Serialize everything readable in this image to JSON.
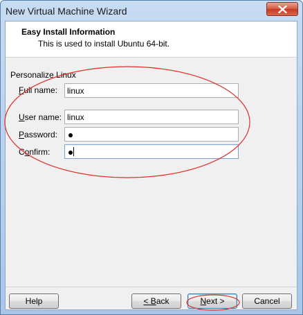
{
  "window": {
    "title": "New Virtual Machine Wizard"
  },
  "header": {
    "title": "Easy Install Information",
    "subtitle": "This is used to install Ubuntu 64-bit."
  },
  "group": {
    "label": "Personalize Linux"
  },
  "fields": {
    "full_name": {
      "label_ul": "F",
      "label_rest": "ull name:",
      "value": "linux"
    },
    "user_name": {
      "label_ul": "U",
      "label_rest": "ser name:",
      "value": "linux"
    },
    "password": {
      "label_ul": "P",
      "label_rest": "assword:"
    },
    "confirm": {
      "label_pre": "C",
      "label_ul": "o",
      "label_rest": "nfirm:"
    }
  },
  "buttons": {
    "help": "Help",
    "back_ul": "< B",
    "back_rest": "ack",
    "next_ul": "N",
    "next_rest": "ext >",
    "cancel": "Cancel"
  },
  "annotation": {
    "color": "#e0302a"
  }
}
